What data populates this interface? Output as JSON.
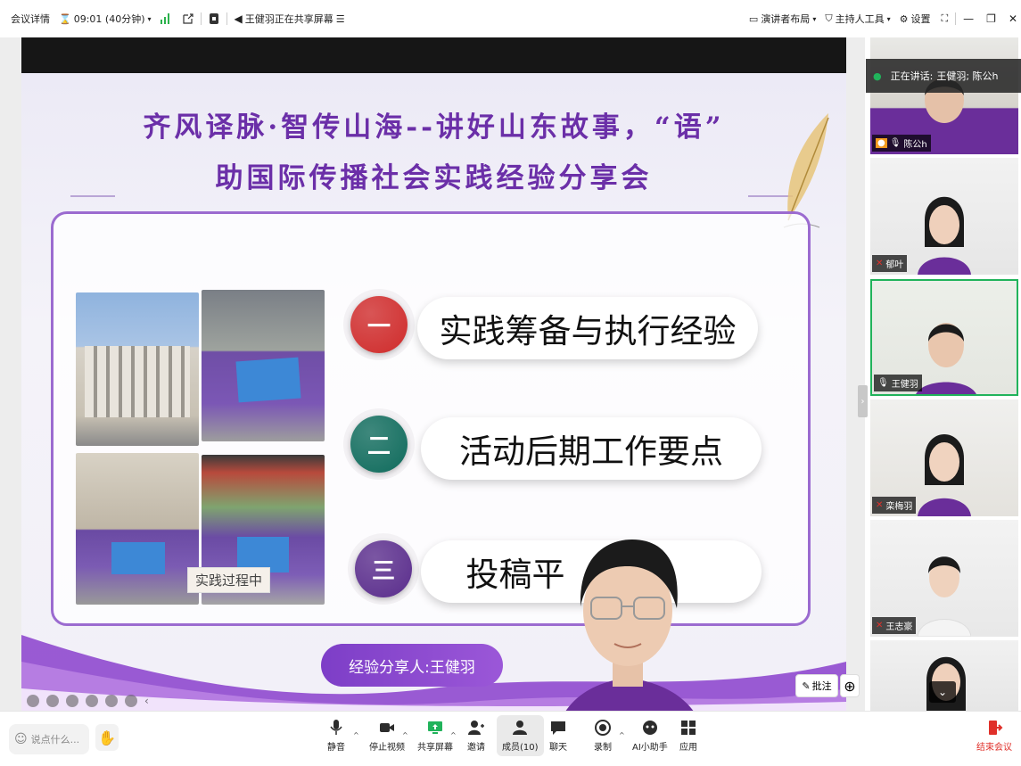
{
  "topbar": {
    "meeting_details": "会议详情",
    "timer": "09:01 (40分钟)",
    "sharing_status": "王健羽正在共享屏幕",
    "layout": "演讲者布局",
    "host_tools": "主持人工具",
    "settings": "设置"
  },
  "slide": {
    "title_line1": "齐风译脉·智传山海--讲好山东故事，“语”",
    "title_line2": "助国际传播社会实践经验分享会",
    "photo_tag": "实践过程中",
    "items": [
      {
        "num": "一",
        "label": "实践筹备与执行经验",
        "color": "#cf2b2b"
      },
      {
        "num": "二",
        "label": "活动后期工作要点",
        "color": "#0f6b5c"
      },
      {
        "num": "三",
        "label": "投稿平",
        "color": "#5a2d8c"
      }
    ],
    "sharer": "经验分享人:王健羽"
  },
  "stage_tools": {
    "annotate": "批注"
  },
  "gallery": {
    "talking_prefix": "正在讲话:",
    "talking_names": "王健羽; 陈公h",
    "participants": [
      {
        "name": "陈公h",
        "muted": false
      },
      {
        "name": "郁叶",
        "muted": true
      },
      {
        "name": "王健羽",
        "muted": false
      },
      {
        "name": "栾梅羽",
        "muted": true
      },
      {
        "name": "王志豪",
        "muted": true
      }
    ]
  },
  "bottombar": {
    "chat_placeholder": "说点什么...",
    "buttons": {
      "mute": "静音",
      "stop_video": "停止视频",
      "share": "共享屏幕",
      "invite": "邀请",
      "members": "成员(10)",
      "chat": "聊天",
      "record": "录制",
      "ai": "AI小助手",
      "apps": "应用"
    },
    "end_meeting": "结束会议"
  },
  "colors": {
    "accent_purple": "#7d3ec7",
    "end_red": "#e0302a",
    "active_green": "#21b35b"
  }
}
